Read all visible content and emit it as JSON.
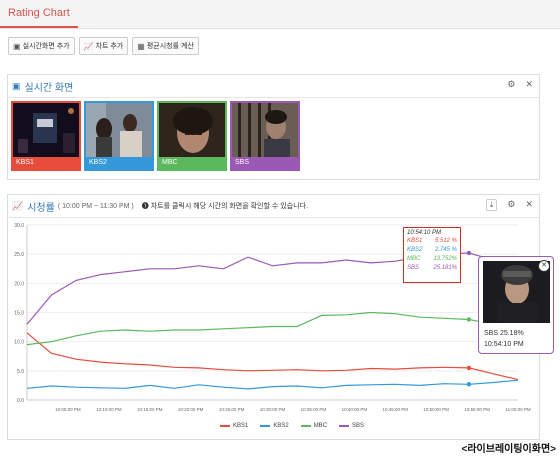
{
  "app": {
    "title": "Rating Chart"
  },
  "toolbar": {
    "buttons": [
      {
        "label": "실시간화면 추가",
        "icon": "square-icon"
      },
      {
        "label": "차트 추가",
        "icon": "line-chart-icon"
      },
      {
        "label": "평균시청률 계산",
        "icon": "table-icon"
      }
    ]
  },
  "live_panel": {
    "title": "실시간 화면",
    "channels": [
      {
        "label": "KBS1",
        "color": "#e74c3c"
      },
      {
        "label": "KBS2",
        "color": "#3498db"
      },
      {
        "label": "MBC",
        "color": "#5cb85c"
      },
      {
        "label": "SBS",
        "color": "#9b59b6"
      }
    ]
  },
  "chart_panel": {
    "title": "시청률",
    "range": "( 10:00 PM ~ 11:30 PM )",
    "notice": "차트를 클릭시 해당 시간의 화면을 확인할 수 있습니다."
  },
  "tooltip": {
    "time": "10:54:10 PM",
    "rows": [
      {
        "name": "KBS1",
        "value": "5.512 %",
        "color": "#e74c3c"
      },
      {
        "name": "KBS2",
        "value": "2.745 %",
        "color": "#3498db"
      },
      {
        "name": "MBC",
        "value": "13.752%",
        "color": "#5cb85c"
      },
      {
        "name": "SBS",
        "value": "25.181%",
        "color": "#9b59b6"
      }
    ]
  },
  "popup": {
    "channel": "SBS 25.18%",
    "time": "10:54:10 PM"
  },
  "caption": "<라이브레이팅이화면>",
  "chart_data": {
    "type": "line",
    "ylim": [
      0,
      30
    ],
    "yticks": [
      "0.0",
      "5.0",
      "10.0",
      "15.0",
      "20.0",
      "25.0",
      "30.0"
    ],
    "xticks": [
      "10:05:00 PM",
      "10:10:00 PM",
      "10:15:00 PM",
      "10:20:00 PM",
      "10:25:00 PM",
      "10:30:00 PM",
      "10:35:00 PM",
      "10:40:00 PM",
      "10:45:00 PM",
      "10:50:00 PM",
      "10:55:00 PM",
      "11:00:00 PM"
    ],
    "x_minutes": [
      0,
      3,
      6,
      9,
      12,
      15,
      18,
      21,
      24,
      27,
      30,
      33,
      36,
      39,
      42,
      45,
      48,
      51,
      54,
      57,
      60
    ],
    "series": [
      {
        "name": "KBS1",
        "color": "#e74c3c",
        "values": [
          11.5,
          8.0,
          7.0,
          6.5,
          6.2,
          6.0,
          5.6,
          5.5,
          5.2,
          5.0,
          5.1,
          5.2,
          5.0,
          5.1,
          5.4,
          5.3,
          5.5,
          5.6,
          5.5,
          4.5,
          3.5
        ]
      },
      {
        "name": "KBS2",
        "color": "#3498db",
        "values": [
          2.0,
          2.4,
          2.2,
          2.1,
          2.0,
          2.5,
          2.0,
          2.6,
          2.2,
          1.9,
          2.3,
          2.4,
          2.1,
          2.5,
          2.6,
          2.7,
          2.5,
          2.8,
          2.7,
          3.0,
          3.4
        ]
      },
      {
        "name": "MBC",
        "color": "#5cb85c",
        "values": [
          9.5,
          10.0,
          11.0,
          11.8,
          12.0,
          11.8,
          12.0,
          12.0,
          12.2,
          12.4,
          12.6,
          12.6,
          14.5,
          14.6,
          15.0,
          14.8,
          14.2,
          14.0,
          13.8,
          13.0,
          12.5
        ]
      },
      {
        "name": "SBS",
        "color": "#9b59b6",
        "values": [
          13.0,
          18.0,
          20.5,
          21.5,
          22.0,
          22.5,
          22.5,
          23.0,
          22.5,
          24.5,
          23.0,
          23.5,
          23.5,
          24.0,
          23.5,
          23.8,
          24.5,
          25.0,
          25.2,
          24.0,
          16.5
        ]
      }
    ],
    "legend": [
      "KBS1",
      "KBS2",
      "MBC",
      "SBS"
    ],
    "legend_position": "bottom"
  }
}
